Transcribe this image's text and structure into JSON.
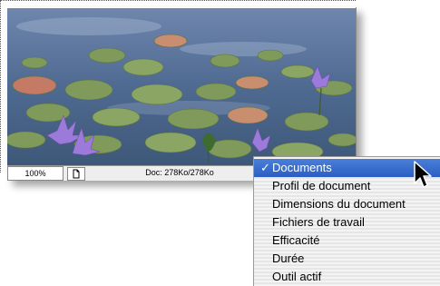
{
  "status_bar": {
    "zoom": "100%",
    "doc_info": "Doc: 278Ko/278Ko"
  },
  "menu": {
    "items": [
      {
        "label": "Documents",
        "selected": true,
        "checked": true
      },
      {
        "label": "Profil de document",
        "selected": false,
        "checked": false
      },
      {
        "label": "Dimensions du document",
        "selected": false,
        "checked": false
      },
      {
        "label": "Fichiers de travail",
        "selected": false,
        "checked": false
      },
      {
        "label": "Efficacité",
        "selected": false,
        "checked": false
      },
      {
        "label": "Durée",
        "selected": false,
        "checked": false
      },
      {
        "label": "Outil actif",
        "selected": false,
        "checked": false
      }
    ],
    "check_glyph": "✓",
    "selected_color": "#2f62c6"
  },
  "icons": {
    "doc": "document-icon",
    "cursor": "arrow-cursor-icon"
  }
}
